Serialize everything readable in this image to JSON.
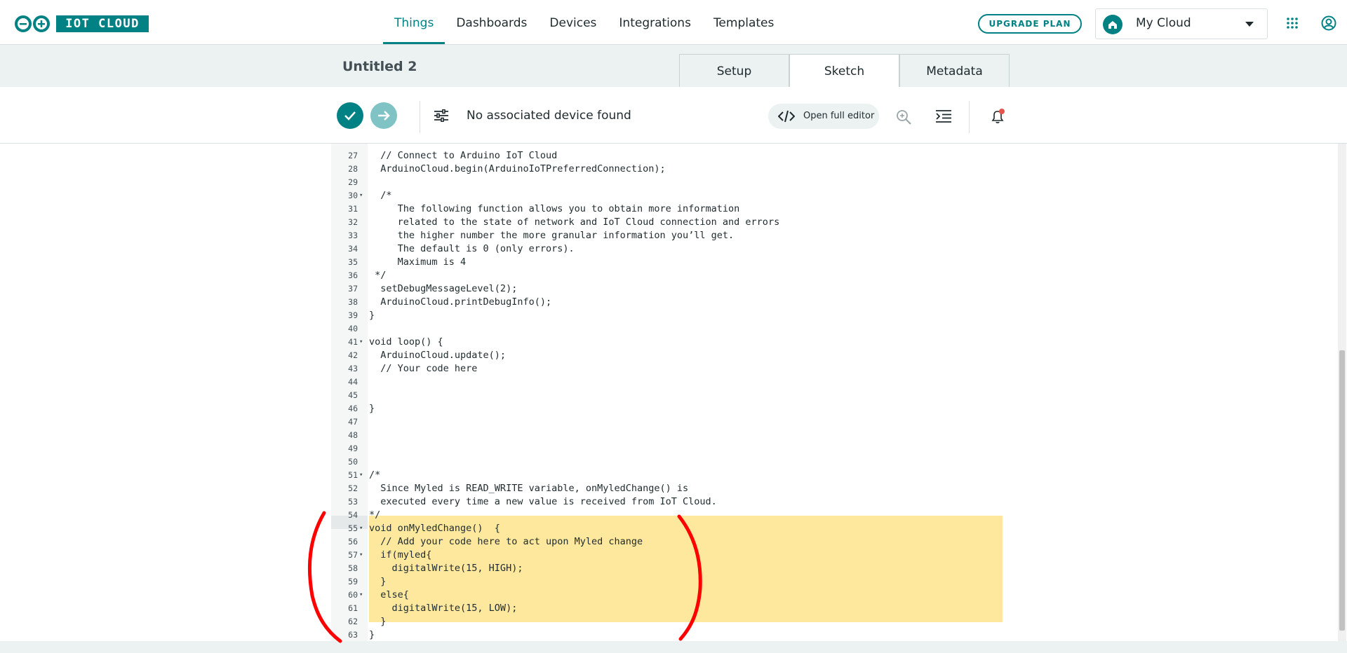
{
  "brand": {
    "logo_text": "IOT CLOUD"
  },
  "nav": {
    "items": [
      {
        "label": "Things",
        "active": true
      },
      {
        "label": "Dashboards",
        "active": false
      },
      {
        "label": "Devices",
        "active": false
      },
      {
        "label": "Integrations",
        "active": false
      },
      {
        "label": "Templates",
        "active": false
      }
    ]
  },
  "header": {
    "upgrade_label": "UPGRADE PLAN",
    "cloud_name": "My Cloud"
  },
  "thing": {
    "title": "Untitled 2"
  },
  "tabs": [
    {
      "label": "Setup",
      "active": false
    },
    {
      "label": "Sketch",
      "active": true
    },
    {
      "label": "Metadata",
      "active": false
    }
  ],
  "toolbar": {
    "device_status": "No associated device found",
    "open_editor_label": "Open full editor"
  },
  "colors": {
    "accent": "#008184",
    "highlight": "#fde89d",
    "annotation": "#ff0000"
  },
  "code": {
    "lines": [
      {
        "n": "27",
        "text": "  // Connect to Arduino IoT Cloud"
      },
      {
        "n": "28",
        "text": "  ArduinoCloud.begin(ArduinoIoTPreferredConnection);"
      },
      {
        "n": "29",
        "text": ""
      },
      {
        "n": "30",
        "text": "  /*",
        "fold": true
      },
      {
        "n": "31",
        "text": "     The following function allows you to obtain more information"
      },
      {
        "n": "32",
        "text": "     related to the state of network and IoT Cloud connection and errors"
      },
      {
        "n": "33",
        "text": "     the higher number the more granular information you’ll get."
      },
      {
        "n": "34",
        "text": "     The default is 0 (only errors)."
      },
      {
        "n": "35",
        "text": "     Maximum is 4"
      },
      {
        "n": "36",
        "text": " */"
      },
      {
        "n": "37",
        "text": "  setDebugMessageLevel(2);"
      },
      {
        "n": "38",
        "text": "  ArduinoCloud.printDebugInfo();"
      },
      {
        "n": "39",
        "text": "}"
      },
      {
        "n": "40",
        "text": ""
      },
      {
        "n": "41",
        "text": "void loop() {",
        "fold": true
      },
      {
        "n": "42",
        "text": "  ArduinoCloud.update();"
      },
      {
        "n": "43",
        "text": "  // Your code here"
      },
      {
        "n": "44",
        "text": ""
      },
      {
        "n": "45",
        "text": ""
      },
      {
        "n": "46",
        "text": "}"
      },
      {
        "n": "47",
        "text": ""
      },
      {
        "n": "48",
        "text": ""
      },
      {
        "n": "49",
        "text": ""
      },
      {
        "n": "50",
        "text": ""
      },
      {
        "n": "51",
        "text": "/*",
        "fold": true
      },
      {
        "n": "52",
        "text": "  Since Myled is READ_WRITE variable, onMyledChange() is"
      },
      {
        "n": "53",
        "text": "  executed every time a new value is received from IoT Cloud."
      },
      {
        "n": "54",
        "text": "*/"
      },
      {
        "n": "55",
        "text": "void onMyledChange()  {",
        "fold": true,
        "hl": true
      },
      {
        "n": "56",
        "text": "  // Add your code here to act upon Myled change",
        "hl": true
      },
      {
        "n": "57",
        "text": "  if(myled{",
        "fold": true,
        "hl": true
      },
      {
        "n": "58",
        "text": "    digitalWrite(15, HIGH);",
        "hl": true
      },
      {
        "n": "59",
        "text": "  }",
        "hl": true
      },
      {
        "n": "60",
        "text": "  else{",
        "fold": true,
        "hl": true
      },
      {
        "n": "61",
        "text": "    digitalWrite(15, LOW);",
        "hl": true
      },
      {
        "n": "62",
        "text": "  }",
        "hl": true
      },
      {
        "n": "63",
        "text": "}",
        "hl": true
      }
    ]
  }
}
